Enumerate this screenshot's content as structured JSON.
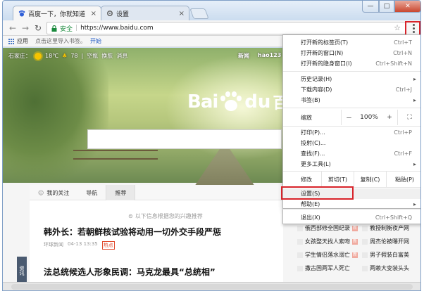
{
  "window": {
    "tabs": [
      {
        "label": "百度一下，你就知道",
        "close": "×",
        "active": true
      },
      {
        "label": "设置",
        "close": "×",
        "active": false
      }
    ],
    "controls": {
      "minimize": "—",
      "maximize": "□",
      "close": "✕"
    }
  },
  "toolbar": {
    "secure_label": "安全",
    "url": "https://www.baidu.com",
    "star": "☆"
  },
  "bookmarks": {
    "apps_label": "应用",
    "hint": "点击这里导入书签。",
    "import_link": "开始"
  },
  "page": {
    "weather": {
      "city": "石家庄：",
      "temp": "18℃",
      "aqi": "78",
      "sep": "|",
      "links": [
        "空瓶",
        "换肤",
        "消息"
      ]
    },
    "top_links": [
      "新闻",
      "hao123"
    ],
    "logo": {
      "bai": "Bai",
      "du": "du",
      "cn": "百度"
    },
    "feed": {
      "tabs": [
        "我的关注",
        "导航",
        "推荐"
      ],
      "hint": "以下信息根据您的兴趣推荐",
      "articles": [
        {
          "title": "韩外长：若朝鲜核试验将动用一切外交手段严惩",
          "source": "环球新闻",
          "time": "04-13 13:35",
          "tag": "热点"
        },
        {
          "title": "法总统候选人形象民调：马克龙最具“总统相”",
          "source": "",
          "time": "",
          "tag": ""
        }
      ],
      "side_tab": "资讯"
    },
    "right_news": [
      {
        "left": "俄西部修全国纪录",
        "right": "教授制衡夜产网"
      },
      {
        "left": "女孩整天找人索吻",
        "right": "周杰伦被曝开网"
      },
      {
        "left": "学生情侣落水溺亡",
        "right": "男子假装白富美"
      },
      {
        "left": "撒古国两军人死亡",
        "right": "两赖大变装头头"
      }
    ]
  },
  "menu": {
    "items_top": [
      {
        "label": "打开新的标签页(T)",
        "shortcut": "Ctrl+T"
      },
      {
        "label": "打开新的窗口(N)",
        "shortcut": "Ctrl+N"
      },
      {
        "label": "打开新的隐身窗口(I)",
        "shortcut": "Ctrl+Shift+N"
      }
    ],
    "items_history": [
      {
        "label": "历史记录(H)",
        "arrow": "▸"
      },
      {
        "label": "下载内容(D)",
        "shortcut": "Ctrl+J"
      },
      {
        "label": "书签(B)",
        "arrow": "▸"
      }
    ],
    "zoom": {
      "label": "缩放",
      "minus": "－",
      "value": "100%",
      "plus": "+",
      "fullscreen": "⛶"
    },
    "items_print": [
      {
        "label": "打印(P)...",
        "shortcut": "Ctrl+P"
      },
      {
        "label": "投射(C)..."
      },
      {
        "label": "查找(F)...",
        "shortcut": "Ctrl+F"
      },
      {
        "label": "更多工具(L)",
        "arrow": "▸"
      }
    ],
    "edit": {
      "label": "修改",
      "cut": "剪切(T)",
      "copy": "复制(C)",
      "paste": "粘贴(P)"
    },
    "items_settings": [
      {
        "label": "设置(S)"
      },
      {
        "label": "帮助(E)",
        "arrow": "▸"
      }
    ],
    "exit": {
      "label": "退出(X)",
      "shortcut": "Ctrl+Shift+Q"
    }
  }
}
